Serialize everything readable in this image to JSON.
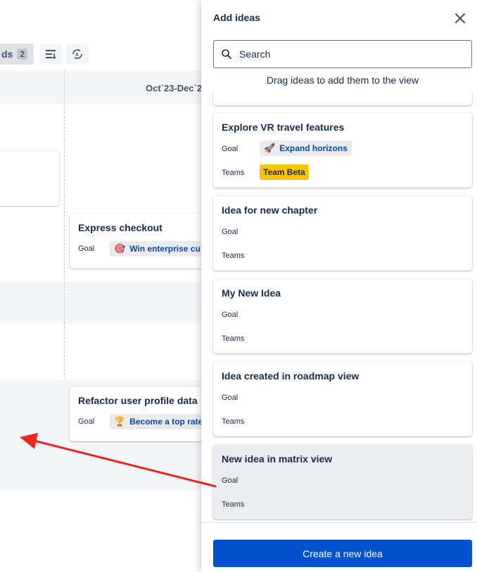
{
  "background": {
    "toolbar_chip_label": "ds",
    "toolbar_chip_count": "2",
    "column_header": "Oct`23-Dec`2",
    "cards": [
      {
        "title": "Express checkout",
        "goal_label": "Goal",
        "goal_emoji": "🎯",
        "goal_text": "Win enterprise cu"
      },
      {
        "title": "Refactor user profile data",
        "goal_label": "Goal",
        "goal_emoji": "🏆",
        "goal_text": "Become a top rate"
      }
    ]
  },
  "drawer": {
    "title": "Add ideas",
    "search": {
      "placeholder": "Search",
      "value": ""
    },
    "hint": "Drag ideas to add them to the view",
    "ideas": [
      {
        "title": "Explore VR travel features",
        "goal_label": "Goal",
        "goal_emoji": "🚀",
        "goal_text": "Expand horizons",
        "teams_label": "Teams",
        "team": "Team Beta"
      },
      {
        "title": "Idea for new chapter",
        "goal_label": "Goal",
        "teams_label": "Teams"
      },
      {
        "title": "My New Idea",
        "goal_label": "Goal",
        "teams_label": "Teams"
      },
      {
        "title": "Idea created in roadmap view",
        "goal_label": "Goal",
        "teams_label": "Teams"
      },
      {
        "title": "New idea in matrix view",
        "goal_label": "Goal",
        "teams_label": "Teams"
      }
    ],
    "create_button": "Create a new idea"
  },
  "colors": {
    "accent": "#0052cc",
    "team_chip": "#ffc400",
    "arrow": "#e8281f"
  },
  "icons": {
    "close": "close-icon",
    "search": "search-icon",
    "group": "group-icon",
    "auto_arrange": "auto-arrange-icon"
  }
}
